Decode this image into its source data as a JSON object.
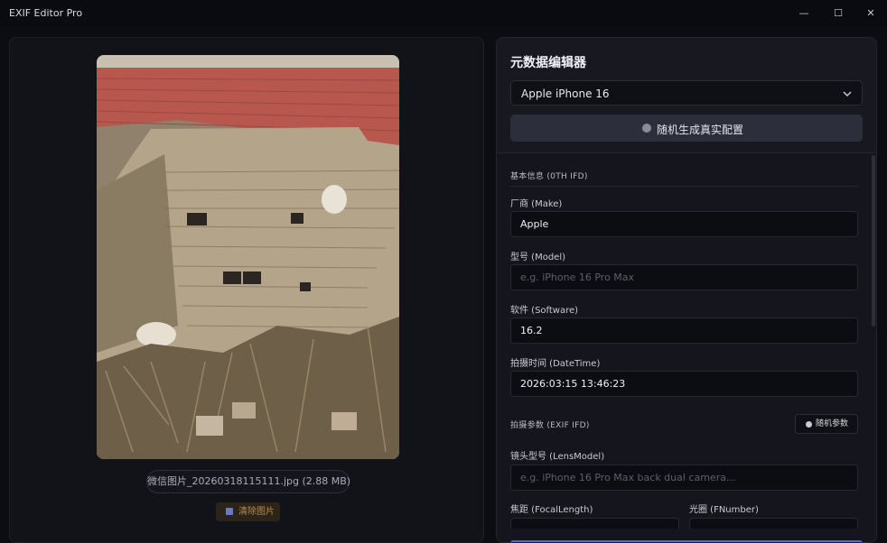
{
  "app": {
    "title": "EXIF Editor Pro"
  },
  "window_controls": {
    "minimize": "—",
    "maximize": "☐",
    "close": "✕"
  },
  "preview": {
    "filename_label": "微信图片_20260318115111.jpg (2.88 MB)",
    "clear_button": "清除图片"
  },
  "editor": {
    "title": "元数据编辑器",
    "device_select": {
      "value": "Apple iPhone 16"
    },
    "random_real_config_button": "随机生成真实配置",
    "sections": {
      "basic": {
        "title": "基本信息 (0TH IFD)"
      },
      "capture": {
        "title": "拍摄参数 (EXIF IFD)",
        "random_button": "随机参数"
      }
    },
    "fields": {
      "make": {
        "label": "厂商 (Make)",
        "value": "Apple"
      },
      "model": {
        "label": "型号 (Model)",
        "placeholder": "e.g. iPhone 16 Pro Max"
      },
      "software": {
        "label": "软件 (Software)",
        "value": "16.2"
      },
      "datetime": {
        "label": "拍摄时间 (DateTime)",
        "value": "2026:03:15 13:46:23"
      },
      "lens_model": {
        "label": "镜头型号 (LensModel)",
        "placeholder": "e.g. iPhone 16 Pro Max back dual camera..."
      },
      "focal_length": {
        "label": "焦距 (FocalLength)"
      },
      "fnumber": {
        "label": "光圈 (FNumber)"
      }
    }
  },
  "colors": {
    "accent": "#5a63c8",
    "panel": "#171820",
    "background": "#0c0d12"
  }
}
